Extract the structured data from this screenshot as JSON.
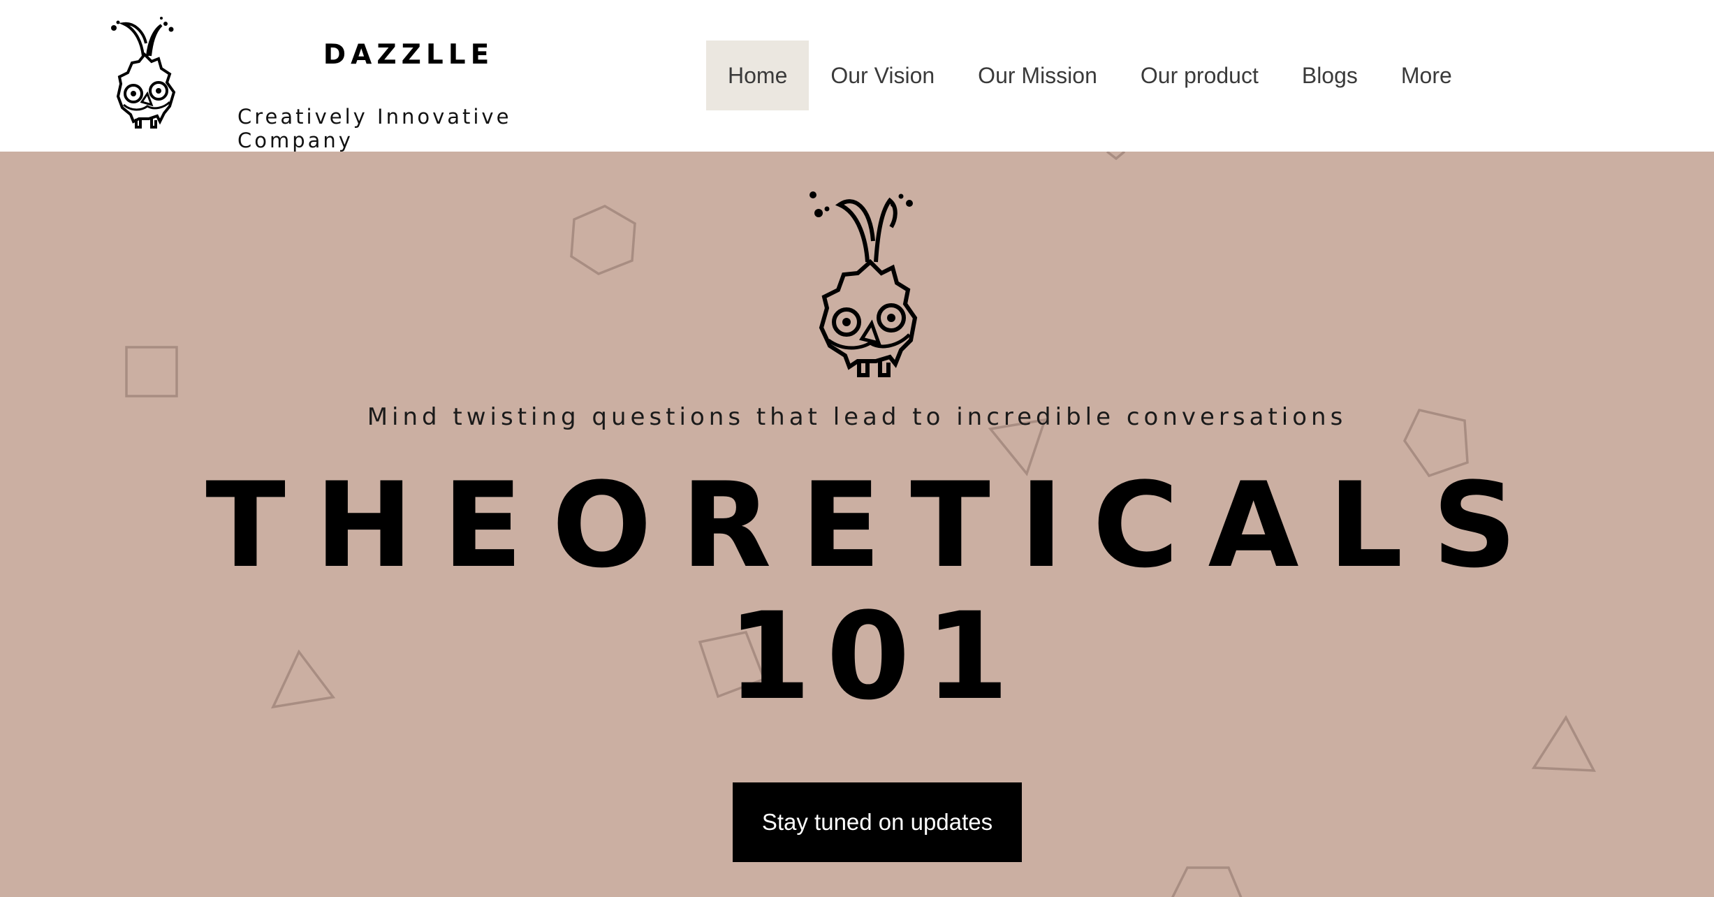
{
  "header": {
    "brand_name": "DAZZLLE",
    "tagline": "Creatively Innovative Company",
    "logo_icon": "owl-sprout-logo-icon"
  },
  "nav": {
    "items": [
      {
        "label": "Home",
        "active": true
      },
      {
        "label": "Our Vision",
        "active": false
      },
      {
        "label": "Our Mission",
        "active": false
      },
      {
        "label": "Our product",
        "active": false
      },
      {
        "label": "Blogs",
        "active": false
      },
      {
        "label": "More",
        "active": false
      }
    ]
  },
  "hero": {
    "subtitle": "Mind twisting questions that lead to incredible conversations",
    "title": "THEORETICALS",
    "number": "101",
    "cta_label": "Stay tuned on updates",
    "background_color": "#cbafa2",
    "shape_color": "#a88d82"
  },
  "colors": {
    "nav_active_bg": "#ebe7e0",
    "cta_bg": "#000000",
    "cta_text": "#ffffff"
  }
}
